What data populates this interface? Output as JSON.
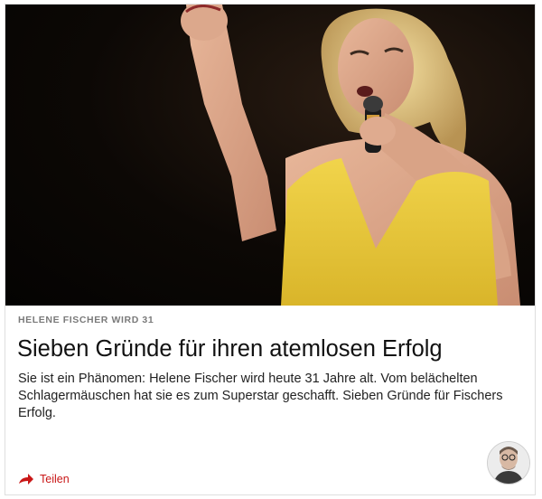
{
  "article": {
    "image_alt": "Helene Fischer singend auf der Bühne im gelben Kleid",
    "kicker": "HELENE FISCHER WIRD 31",
    "headline": "Sieben Gründe für ihren atemlosen Erfolg",
    "teaser": "Sie ist ein Phänomen: Helene Fischer wird heute 31 Jahre alt. Vom belächelten Schlagermäuschen hat sie es zum Superstar geschafft. Sieben Gründe für Fischers Erfolg."
  },
  "actions": {
    "share_label": "Teilen",
    "share_icon": "share-arrow-icon",
    "accent_color": "#c91717"
  },
  "author": {
    "avatar_icon": "author-avatar"
  }
}
